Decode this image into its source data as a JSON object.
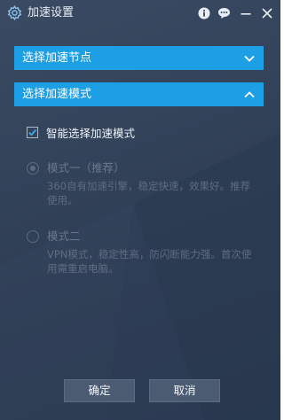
{
  "window": {
    "title": "加速设置",
    "title_icon": "gear-icon",
    "controls": [
      {
        "name": "info-icon",
        "glyph": "i"
      },
      {
        "name": "chat-icon",
        "glyph": "..."
      },
      {
        "name": "minimize-icon",
        "glyph": "—"
      },
      {
        "name": "close-icon",
        "glyph": "✕"
      }
    ]
  },
  "sections": [
    {
      "label": "选择加速节点",
      "expanded": false,
      "chevron": "chevron-down-icon"
    },
    {
      "label": "选择加速模式",
      "expanded": true,
      "chevron": "chevron-up-icon"
    }
  ],
  "smart_mode": {
    "label": "智能选择加速模式",
    "checked": true
  },
  "mode_options": [
    {
      "title": "模式一（推荐）",
      "description": "360自有加速引擎，稳定快速，效果好。推荐使用。",
      "selected": true,
      "disabled": true
    },
    {
      "title": "模式二",
      "description": "VPN模式，稳定性高，防闪断能力强。首次使用需重启电脑。",
      "selected": false,
      "disabled": true
    }
  ],
  "buttons": {
    "ok": "确定",
    "cancel": "取消"
  },
  "colors": {
    "accent": "#1d9fe6",
    "background": "#33435a",
    "button": "#4b5b71"
  }
}
